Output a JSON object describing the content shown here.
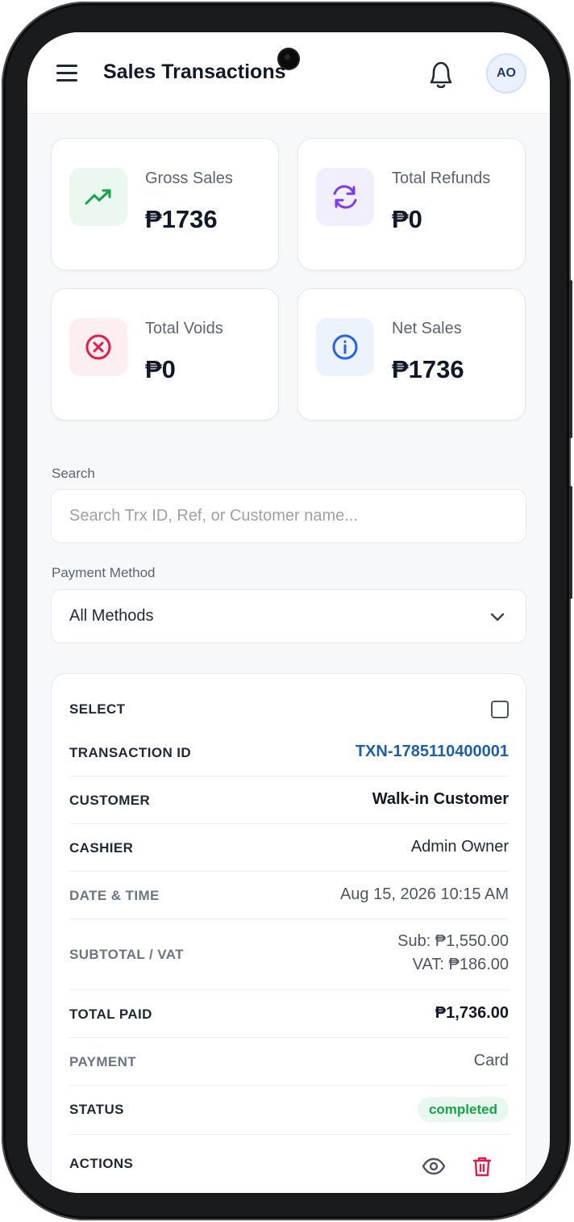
{
  "header": {
    "title": "Sales Transactions",
    "avatar_initials": "AO",
    "menu_icon": "hamburger-menu-icon",
    "bell_icon": "bell-icon"
  },
  "stats": [
    {
      "label": "Gross Sales",
      "value": "₱1736",
      "icon": "trending-up-icon",
      "color": "#16a34a",
      "bg": "#eaf8ef"
    },
    {
      "label": "Total Refunds",
      "value": "₱0",
      "icon": "refresh-icon",
      "color": "#7c3aed",
      "bg": "#f2effd"
    },
    {
      "label": "Total Voids",
      "value": "₱0",
      "icon": "x-circle-icon",
      "color": "#e11d48",
      "bg": "#fdeef1"
    },
    {
      "label": "Net Sales",
      "value": "₱1736",
      "icon": "info-icon",
      "color": "#2563eb",
      "bg": "#edf3fd"
    }
  ],
  "filters": {
    "search_label": "Search",
    "search_placeholder": "Search Trx ID, Ref, or Customer name...",
    "payment_label": "Payment Method",
    "payment_selected": "All Methods"
  },
  "transaction": {
    "select_label": "SELECT",
    "id_label": "TRANSACTION ID",
    "id_value": "TXN-1785110400001",
    "customer_label": "CUSTOMER",
    "customer_value": "Walk-in Customer",
    "cashier_label": "CASHIER",
    "cashier_value": "Admin Owner",
    "datetime_label": "DATE & TIME",
    "datetime_value": "Aug 15, 2026 10:15 AM",
    "subtotal_label": "SUBTOTAL / VAT",
    "subtotal_value": "Sub: ₱1,550.00",
    "vat_value": "VAT: ₱186.00",
    "total_label": "TOTAL PAID",
    "total_value": "₱1,736.00",
    "payment_label": "PAYMENT",
    "payment_value": "Card",
    "status_label": "STATUS",
    "status_value": "completed",
    "actions_label": "ACTIONS"
  },
  "colors": {
    "accent_link": "#1d5fa8",
    "status_green": "#16a34a",
    "danger": "#e11d48"
  }
}
